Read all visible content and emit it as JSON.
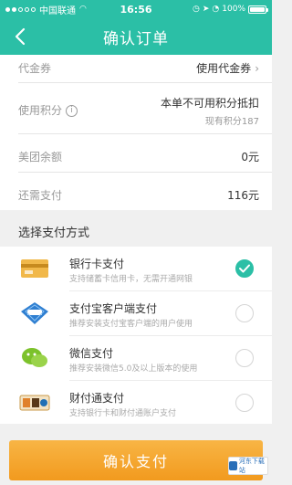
{
  "status_bar": {
    "carrier": "中国联通",
    "time": "16:56",
    "battery": "100%"
  },
  "header": {
    "title": "确认订单"
  },
  "order": {
    "voucher_label": "代金券",
    "voucher_value": "使用代金券",
    "points_label": "使用积分",
    "points_value": "本单不可用积分抵扣",
    "points_sub": "现有积分187",
    "balance_label": "美团余额",
    "balance_value": "0元",
    "due_label": "还需支付",
    "due_value": "116元"
  },
  "payment": {
    "section_title": "选择支付方式",
    "methods": [
      {
        "name": "银行卡支付",
        "desc": "支持储蓄卡信用卡，无需开通网银",
        "selected": true
      },
      {
        "name": "支付宝客户端支付",
        "desc": "推荐安装支付宝客户端的用户使用",
        "selected": false
      },
      {
        "name": "微信支付",
        "desc": "推荐安装微信5.0及以上版本的使用",
        "selected": false
      },
      {
        "name": "财付通支付",
        "desc": "支持银行卡和财付通账户支付",
        "selected": false
      }
    ]
  },
  "footer": {
    "confirm_label": "确认支付"
  },
  "watermark": {
    "text": "河东下载站"
  },
  "colors": {
    "brand": "#2bbfa6",
    "confirm": "#f29a1e"
  }
}
